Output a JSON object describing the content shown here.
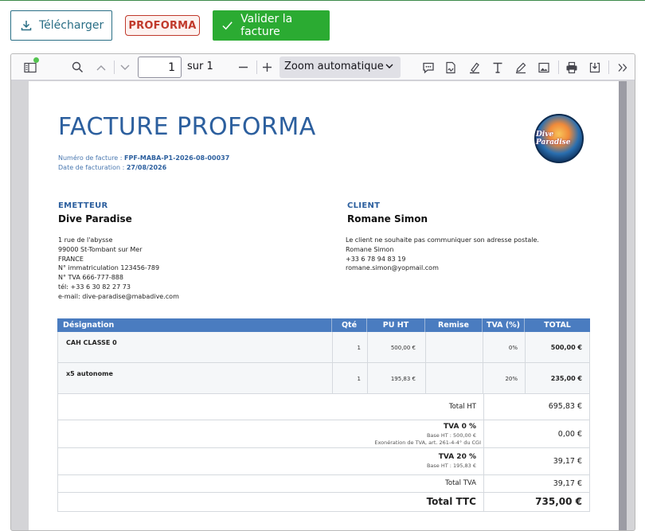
{
  "actions": {
    "download_label": "Télécharger",
    "proforma_badge": "PROFORMA",
    "validate_label": "Valider la facture"
  },
  "viewer": {
    "page_number": "1",
    "page_of": "sur 1",
    "zoom": "Zoom automatique",
    "colors": {
      "toolbar_bg": "#f9f9fa",
      "viewer_bg": "#d4d4d7"
    }
  },
  "invoice": {
    "title": "FACTURE PROFORMA",
    "number_label": "Numéro de facture :",
    "number": "FPF-MABA-P1-2026-08-00037",
    "date_label": "Date de facturation :",
    "date": "27/08/2026",
    "logo_text": "Dive Paradise",
    "issuer": {
      "label": "EMETTEUR",
      "name": "Dive Paradise",
      "lines": [
        "1 rue de l'abysse",
        "99000 St-Tombant sur Mer",
        "FRANCE",
        "N° immatriculation 123456-789",
        "N° TVA 666-777-888",
        "tél: +33 6 30 82 27 73",
        "e-mail: dive-paradise@mabadive.com"
      ]
    },
    "client": {
      "label": "CLIENT",
      "name": "Romane Simon",
      "lines": [
        "Le client ne souhaite pas communiquer son adresse postale.",
        "Romane Simon",
        "+33 6 78 94 83 19",
        "romane.simon@yopmail.com"
      ]
    },
    "table": {
      "headers": [
        "Désignation",
        "Qté",
        "PU HT",
        "Remise",
        "TVA (%)",
        "TOTAL"
      ],
      "rows": [
        {
          "designation": "CAH CLASSE 0",
          "qty": "1",
          "pu_ht": "500,00 €",
          "remise": "",
          "tva": "0%",
          "total": "500,00 €"
        },
        {
          "designation": "x5 autonome",
          "qty": "1",
          "pu_ht": "195,83 €",
          "remise": "",
          "tva": "20%",
          "total": "235,00 €"
        }
      ]
    },
    "totals": {
      "ht_label": "Total HT",
      "ht_value": "695,83 €",
      "tva0_label": "TVA 0 %",
      "tva0_base": "Base HT : 500,00 €",
      "tva0_note": "Exonération de TVA, art. 261-4-4° du CGI",
      "tva0_value": "0,00 €",
      "tva20_label": "TVA 20 %",
      "tva20_base": "Base HT : 195,83 €",
      "tva20_value": "39,17 €",
      "tva_total_label": "Total TVA",
      "tva_total_value": "39,17 €",
      "ttc_label": "Total TTC",
      "ttc_value": "735,00 €"
    }
  }
}
